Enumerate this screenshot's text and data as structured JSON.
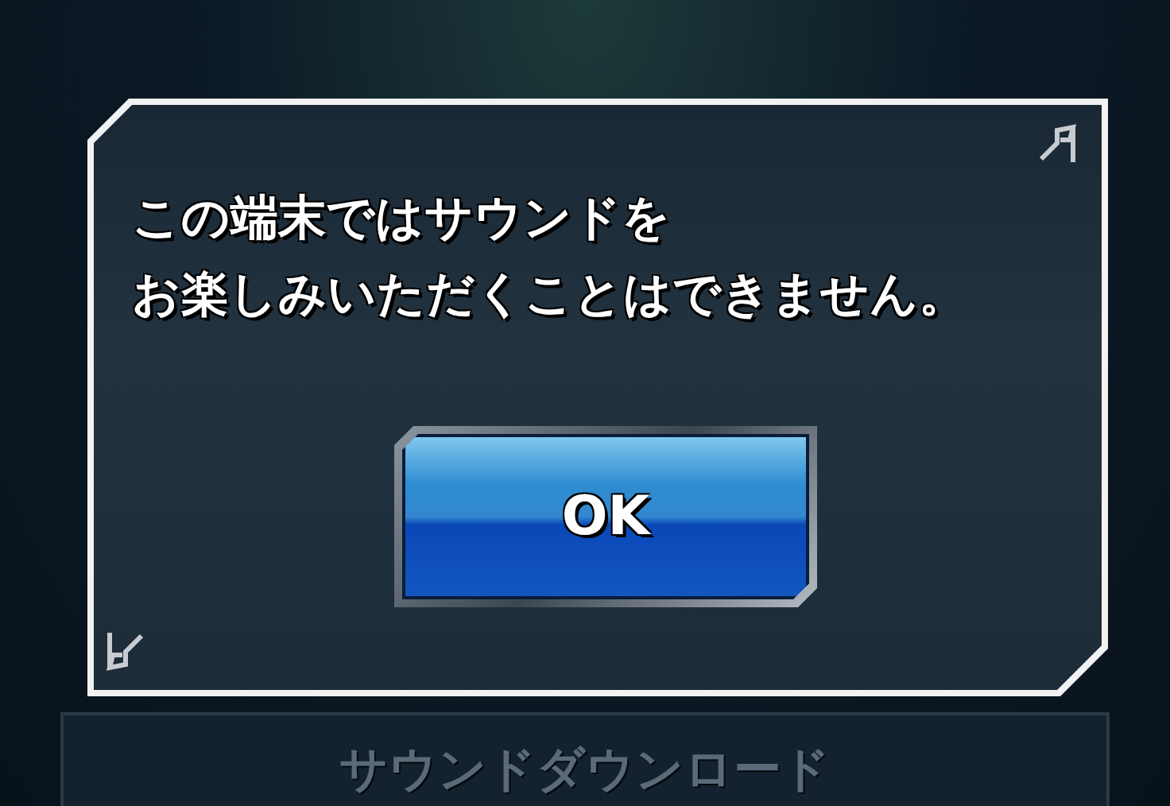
{
  "dialog": {
    "message": [
      "この端末ではサウンドを",
      "お楽しみいただくことはできません。"
    ],
    "button": "OK"
  },
  "background_panel": {
    "label": "サウンドダウンロード"
  }
}
